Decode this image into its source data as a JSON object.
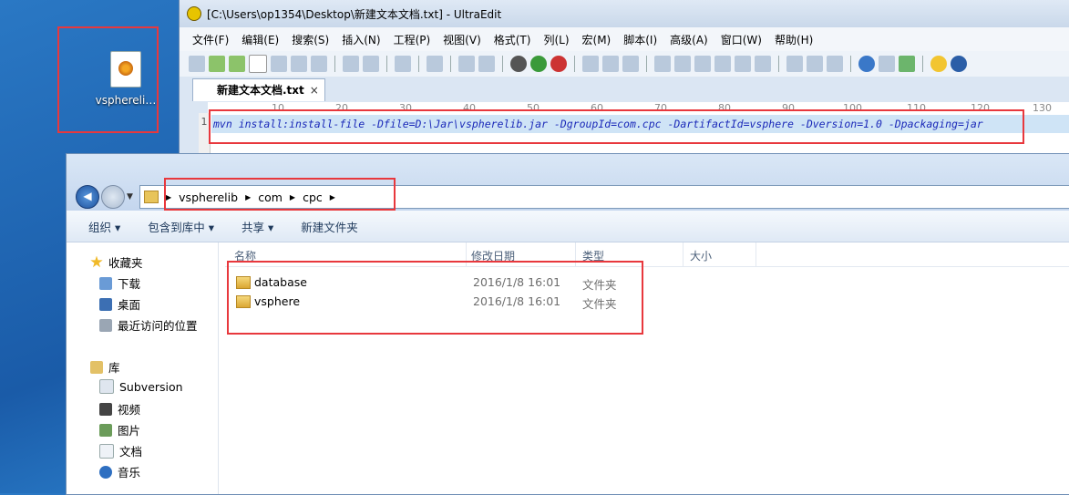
{
  "desktop": {
    "icon_label": "vspherelі…"
  },
  "ultraedit": {
    "title": "[C:\\Users\\op1354\\Desktop\\新建文本文档.txt] - UltraEdit",
    "menu": [
      "文件(F)",
      "编辑(E)",
      "搜索(S)",
      "插入(N)",
      "工程(P)",
      "视图(V)",
      "格式(T)",
      "列(L)",
      "宏(M)",
      "脚本(I)",
      "高级(A)",
      "窗口(W)",
      "帮助(H)"
    ],
    "tab": "新建文本文档.txt",
    "tab_close": "×",
    "ruler": [
      "10",
      "20",
      "30",
      "40",
      "50",
      "60",
      "70",
      "80",
      "90",
      "100",
      "110",
      "120",
      "130"
    ],
    "line_number": "1",
    "code": "mvn install:install-file -Dfile=D:\\Jar\\vspherelib.jar -DgroupId=com.cpc -DartifactId=vsphere -Dversion=1.0 -Dpackaging=jar"
  },
  "explorer": {
    "breadcrumb": [
      "vspherelib",
      "com",
      "cpc"
    ],
    "commands": [
      "组织 ▾",
      "包含到库中 ▾",
      "共享 ▾",
      "新建文件夹"
    ],
    "sidebar": {
      "favorites": "收藏夹",
      "fav_items": [
        "下载",
        "桌面",
        "最近访问的位置"
      ],
      "library": "库",
      "lib_items": [
        "Subversion",
        "视频",
        "图片",
        "文档",
        "音乐"
      ]
    },
    "columns": [
      "名称",
      "修改日期",
      "类型",
      "大小"
    ],
    "rows": [
      {
        "name": "database",
        "date": "2016/1/8 16:01",
        "type": "文件夹"
      },
      {
        "name": "vsphere",
        "date": "2016/1/8 16:01",
        "type": "文件夹"
      }
    ]
  }
}
